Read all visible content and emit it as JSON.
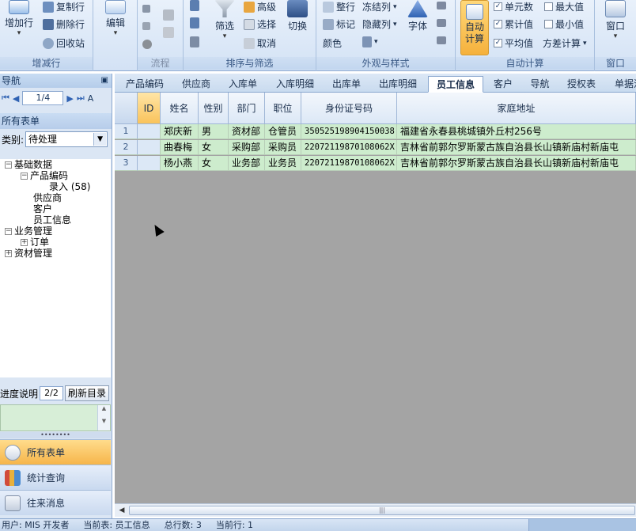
{
  "ribbon": {
    "groups": {
      "rows": {
        "label": "增减行",
        "add_row": "增加行",
        "copy_row": "复制行",
        "delete_row": "删除行",
        "recycle_bin": "回收站"
      },
      "edit": {
        "label": "编辑"
      },
      "flow": {
        "label": "流程"
      },
      "sort_filter": {
        "label": "排序与筛选",
        "filter": "筛选",
        "advanced": "高级",
        "select": "选择",
        "cancel": "取消",
        "toggle": "切换"
      },
      "appearance": {
        "label": "外观与样式",
        "whole_row": "整行",
        "freeze": "冻结列",
        "mark": "标记",
        "hide_col": "隐藏列",
        "color": "颜色",
        "font": "字体"
      },
      "autocalc": {
        "label": "自动计算",
        "auto_calc": "自动计算",
        "cell_count": "单元数",
        "max": "最大值",
        "cumulative": "累计值",
        "min": "最小值",
        "average": "平均值",
        "variance": "方差计算"
      },
      "window": {
        "label": "窗口",
        "window": "窗口"
      }
    }
  },
  "nav": {
    "title": "导航",
    "pager": {
      "first": "⏮",
      "prev": "◀",
      "page": "1/4",
      "next": "▶",
      "last": "⏭",
      "az": "A"
    },
    "all_forms_header": "所有表单",
    "category_label": "类别:",
    "category_value": "待处理",
    "tree": {
      "basic_data": "基础数据",
      "product_code": "产品编码",
      "entry": "录入 (58)",
      "supplier": "供应商",
      "customer": "客户",
      "employee_info": "员工信息",
      "business_mgmt": "业务管理",
      "order": "订单",
      "material_mgmt": "资材管理"
    },
    "progress_label": "进度说明",
    "progress_value": "2/2",
    "refresh_button": "刷新目录",
    "buttons": {
      "all_forms": "所有表单",
      "stats_query": "统计查询",
      "messages": "往来消息"
    }
  },
  "tabs": [
    "产品编码",
    "供应商",
    "入库单",
    "入库明细",
    "出库单",
    "出库明细",
    "员工信息",
    "客户",
    "导航",
    "授权表",
    "单据流"
  ],
  "active_tab": "员工信息",
  "grid": {
    "columns": [
      "ID",
      "姓名",
      "性别",
      "部门",
      "职位",
      "身份证号码",
      "家庭地址"
    ],
    "rows": [
      {
        "rn": "1",
        "id": "",
        "name": "郑庆新",
        "gender": "男",
        "dept": "资材部",
        "position": "仓管员",
        "idcard": "350525198904150038",
        "address": "福建省永春县桃城镇外丘村256号"
      },
      {
        "rn": "2",
        "id": "",
        "name": "曲春梅",
        "gender": "女",
        "dept": "采购部",
        "position": "采购员",
        "idcard": "22072119870108062X",
        "address": "吉林省前郭尔罗斯蒙古族自治县长山镇新庙村新庙屯"
      },
      {
        "rn": "3",
        "id": "",
        "name": "杨小燕",
        "gender": "女",
        "dept": "业务部",
        "position": "业务员",
        "idcard": "22072119870108062X",
        "address": "吉林省前郭尔罗斯蒙古族自治县长山镇新庙村新庙屯"
      }
    ]
  },
  "status": {
    "user": "用户: MIS 开发者",
    "current_table": "当前表: 员工信息",
    "total_rows": "总行数: 3",
    "current_row": "当前行: 1"
  }
}
